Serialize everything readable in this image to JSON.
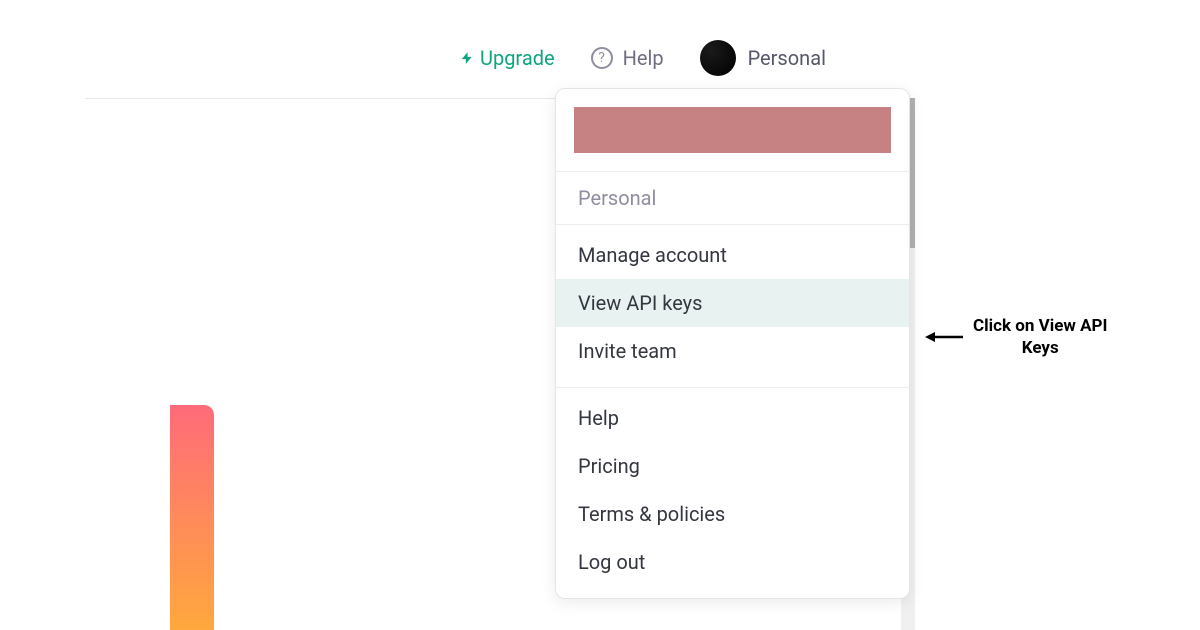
{
  "header": {
    "upgrade_label": "Upgrade",
    "help_label": "Help",
    "personal_label": "Personal"
  },
  "dropdown": {
    "section_label": "Personal",
    "items_group1": [
      {
        "label": "Manage account",
        "highlighted": false
      },
      {
        "label": "View API keys",
        "highlighted": true
      },
      {
        "label": "Invite team",
        "highlighted": false
      }
    ],
    "items_group2": [
      {
        "label": "Help"
      },
      {
        "label": "Pricing"
      },
      {
        "label": "Terms & policies"
      },
      {
        "label": "Log out"
      }
    ]
  },
  "callout": {
    "text_line1": "Click on View API",
    "text_line2": "Keys"
  }
}
